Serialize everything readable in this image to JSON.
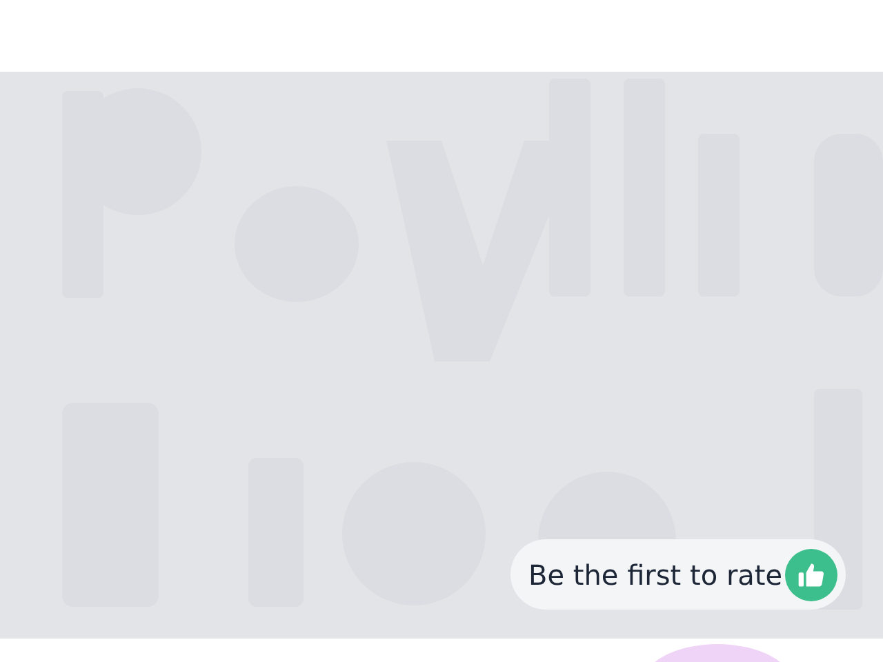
{
  "rating": {
    "label": "Be the first to rate"
  }
}
